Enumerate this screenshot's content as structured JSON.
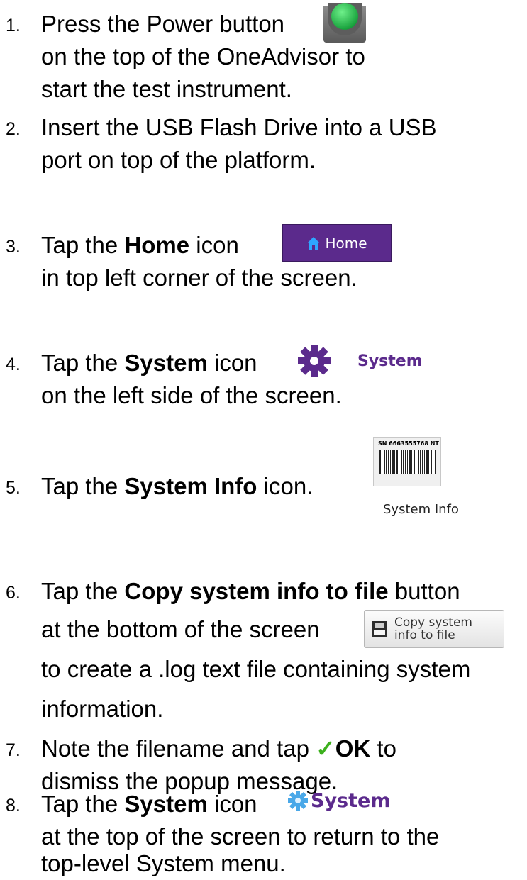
{
  "steps": [
    {
      "number": "1.",
      "lines": [
        "Press the Power button",
        "on the top of the OneAdvisor to",
        "start the test instrument."
      ]
    },
    {
      "number": "2.",
      "lines": [
        "Insert the USB Flash Drive into a USB",
        "port on top of the platform."
      ]
    },
    {
      "number": "3.",
      "prefix": "Tap the ",
      "bold": "Home",
      "suffix": " icon",
      "line2": "in top left corner of the screen.",
      "icon_label": "Home"
    },
    {
      "number": "4.",
      "prefix": "Tap the ",
      "bold": "System",
      "suffix": " icon",
      "line2": "on the left side of the screen.",
      "icon_label": "System"
    },
    {
      "number": "5.",
      "prefix": "Tap the ",
      "bold": "System Info",
      "suffix": " icon.",
      "barcode_text": "SN 6663555768 NT",
      "icon_label": "System Info"
    },
    {
      "number": "6.",
      "prefix": "Tap the ",
      "bold": "Copy system info to file",
      "suffix": " button",
      "line2": "at the bottom of the screen",
      "line3": "to create a .log text file containing system",
      "line4": "information.",
      "button_line1": "Copy system",
      "button_line2": "info to file"
    },
    {
      "number": "7.",
      "prefix": "Note the filename and tap ",
      "check": "✓",
      "bold": "OK",
      "suffix": " to",
      "line2": "dismiss the popup message."
    },
    {
      "number": "8.",
      "prefix": "Tap the ",
      "bold": "System",
      "suffix": " icon",
      "line2": "at the top of the screen to return to the",
      "line3": "top-level System menu.",
      "icon_label": "System"
    }
  ],
  "colors": {
    "brand_purple": "#5b2a8c",
    "check_green": "#3cb01d",
    "power_led_green": "#1aa33e"
  },
  "icons": [
    "power-button-icon",
    "home-icon",
    "gear-icon",
    "barcode-icon",
    "floppy-disk-icon",
    "check-icon"
  ]
}
